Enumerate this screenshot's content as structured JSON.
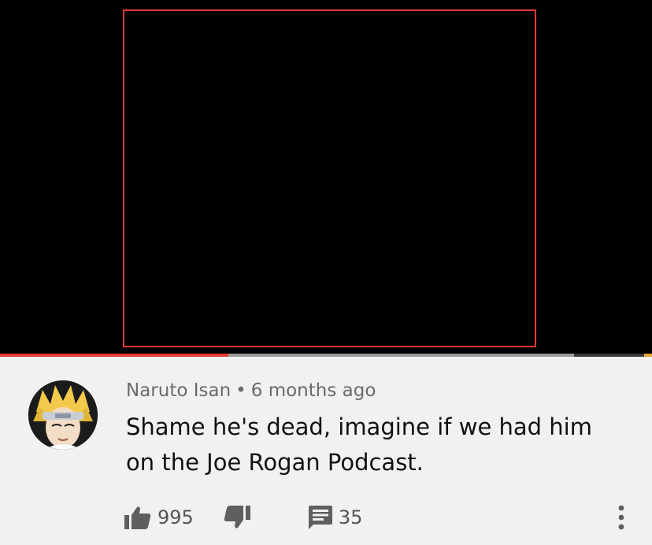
{
  "comment": {
    "author": "Naruto Isan",
    "separator": "•",
    "time": "6 months ago",
    "text": "Shame he's dead, imagine if we had him on the Joe Rogan Podcast.",
    "likes": "995",
    "replies": "35"
  },
  "icons": {
    "like": "thumbs-up-icon",
    "dislike": "thumbs-down-icon",
    "reply": "comment-icon",
    "more": "vertical-dots-icon"
  },
  "colors": {
    "progress_played": "#e53935",
    "frame_border": "#e53935",
    "background": "#f1f1f1"
  },
  "video": {
    "progress_played": 0.35,
    "progress_buffered": 0.88
  }
}
